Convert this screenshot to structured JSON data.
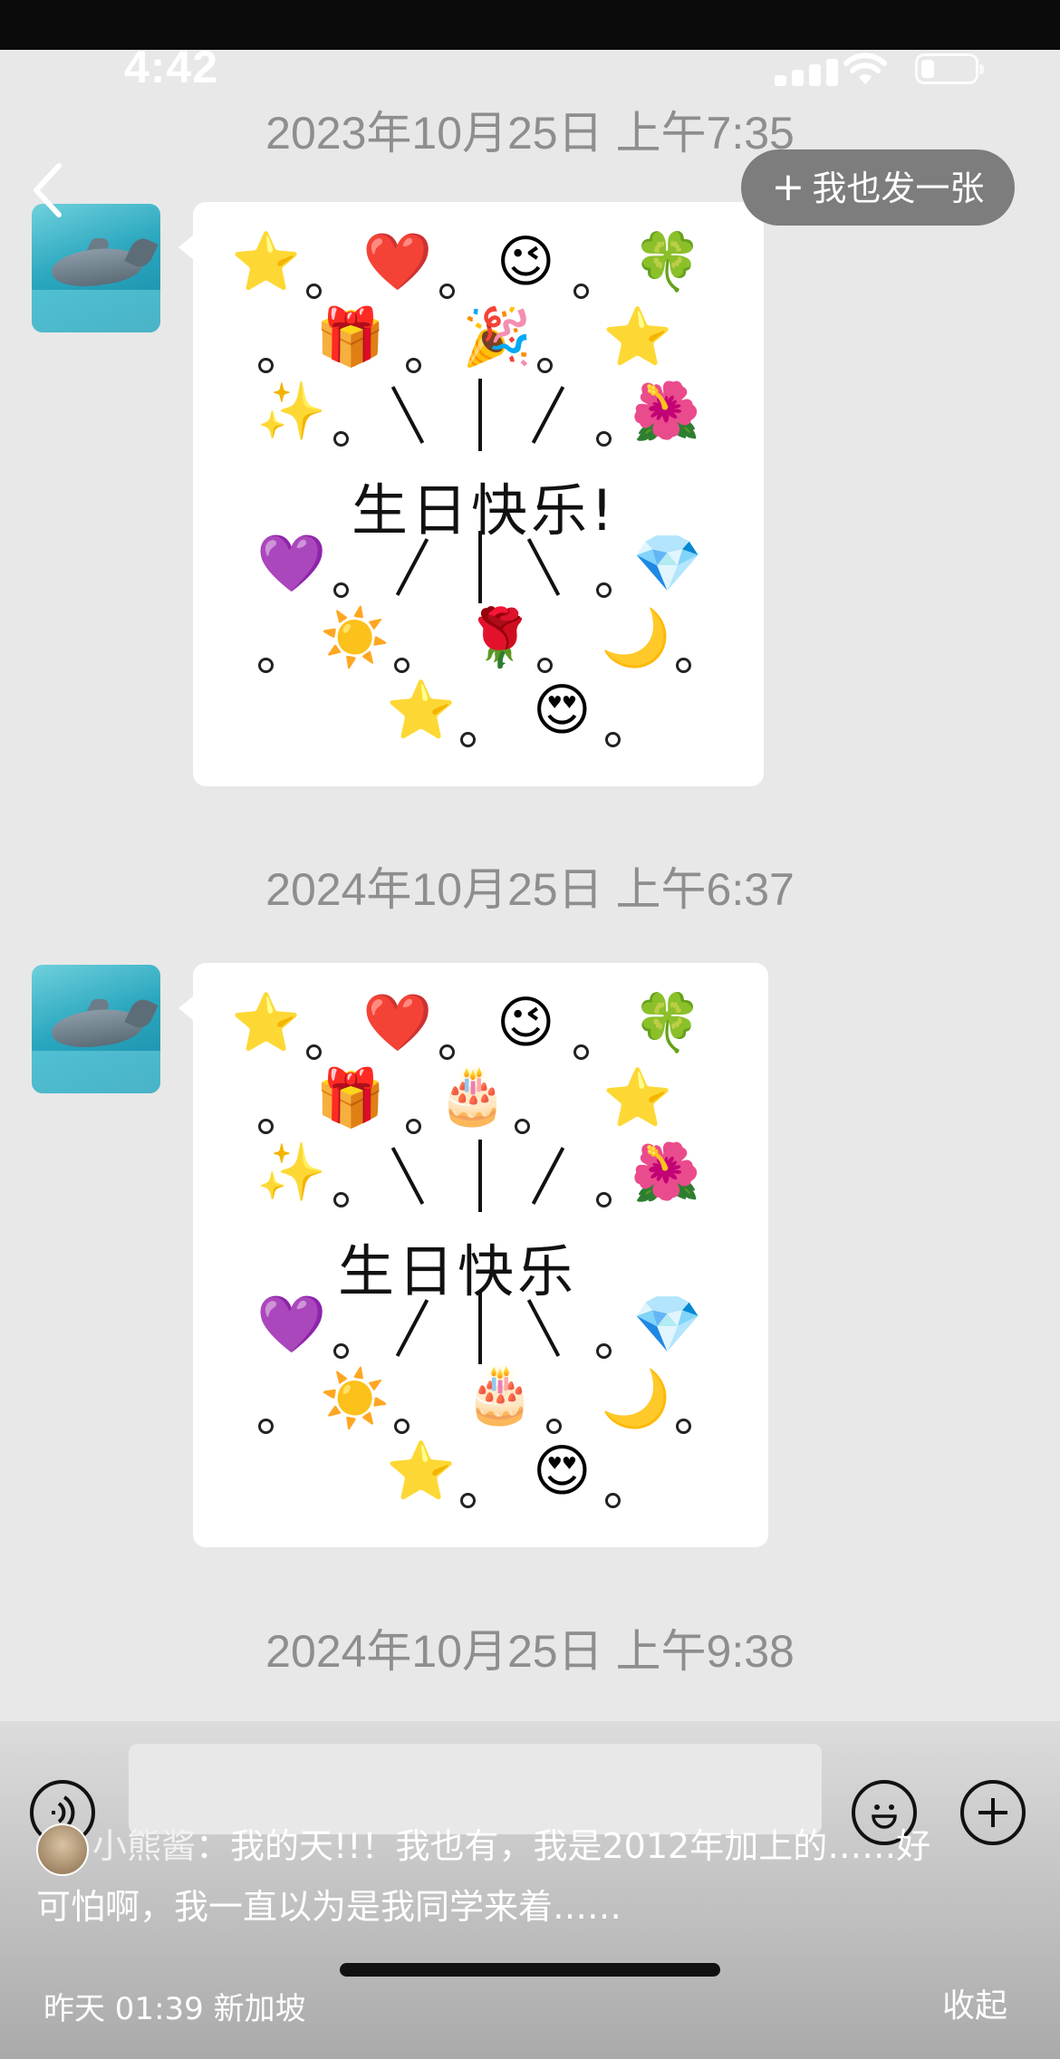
{
  "status_bar": {
    "time": "4:42"
  },
  "nav": {
    "share_button_label": "我也发一张"
  },
  "messages": [
    {
      "timestamp": "2023年10月25日 上午7:35",
      "greeting": "生日快乐!"
    },
    {
      "timestamp": "2024年10月25日 上午6:37",
      "greeting": "生日快乐"
    }
  ],
  "last_timestamp": "2024年10月25日 上午9:38",
  "comment": {
    "author": "小熊酱",
    "text_line1": "：我的天!!！我也有，我是2012年加上的……好",
    "text_line2": "可怕啊，我一直以为是我同学来着……",
    "time": "昨天 01:39",
    "location": "新加坡",
    "collapse_label": "收起"
  },
  "icons": {
    "back": "chevron-left-icon",
    "voice": "voice-icon",
    "emoji": "emoji-icon",
    "plus": "plus-icon"
  }
}
